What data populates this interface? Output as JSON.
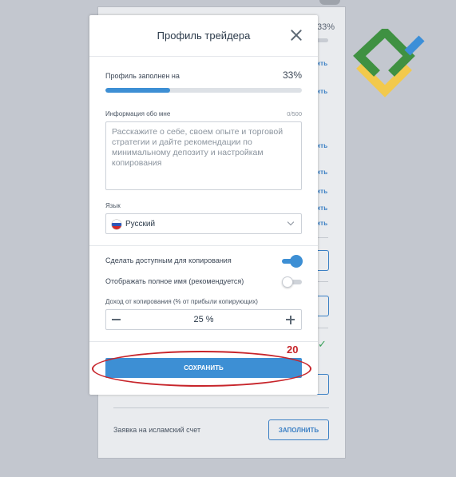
{
  "modal": {
    "title": "Профиль трейдера",
    "progress": {
      "label": "Профиль заполнен на",
      "value_text": "33%",
      "fraction": 0.33
    },
    "about": {
      "label": "Информация обо мне",
      "counter": "0/500",
      "placeholder": "Расскажите о себе, своем опыте и торговой стратегии и дайте рекомендации по минимальному депозиту и настройкам копирования",
      "value": ""
    },
    "language": {
      "label": "Язык",
      "selected": "Русский"
    },
    "toggles": [
      {
        "label": "Сделать доступным для копирования",
        "on": true
      },
      {
        "label": "Отображать полное имя (рекомендуется)",
        "on": false
      }
    ],
    "income": {
      "label": "Доход от копирования (% от прибыли копирующих)",
      "value": "25 %"
    },
    "save_label": "СОХРАНИТЬ"
  },
  "annotation": {
    "number": "20",
    "color": "#c7252b"
  },
  "background": {
    "percent": "33%",
    "link_fragment": "ить",
    "islamic_label": "Заявка на исламский счет",
    "fill_button": "ЗАПОЛНИТЬ"
  },
  "colors": {
    "accent": "#3d8fd4",
    "backdrop": "#c3c7cf"
  }
}
